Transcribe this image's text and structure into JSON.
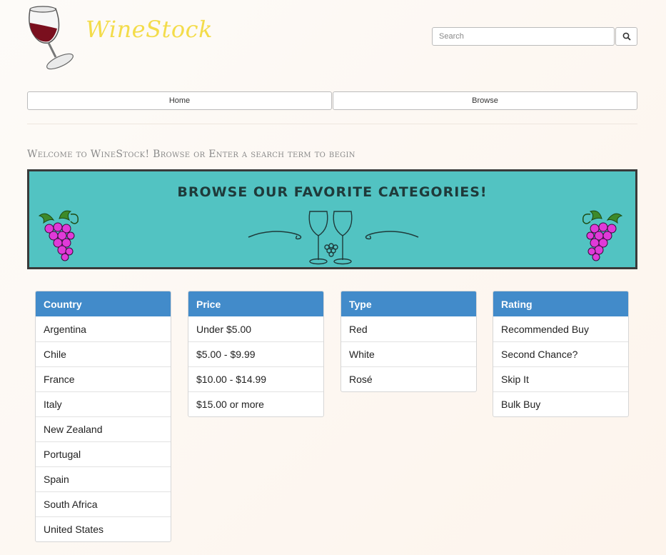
{
  "brand": {
    "name": "WineStock",
    "logo_icon": "wine-glass-icon",
    "accent": "#f3dc4a"
  },
  "search": {
    "placeholder": "Search",
    "icon": "search-icon"
  },
  "nav": {
    "home_label": "Home",
    "browse_label": "Browse"
  },
  "welcome": "Welcome to WineStock! Browse or Enter a search term to begin",
  "banner": {
    "title": "Browse our favorite categories!",
    "background": "#52c3c2",
    "icons": [
      "grapes-icon",
      "wine-glasses-icon",
      "grapes-icon"
    ]
  },
  "categories": {
    "country": {
      "title": "Country",
      "items": [
        "Argentina",
        "Chile",
        "France",
        "Italy",
        "New Zealand",
        "Portugal",
        "Spain",
        "South Africa",
        "United States"
      ]
    },
    "price": {
      "title": "Price",
      "items": [
        "Under $5.00",
        "$5.00 - $9.99",
        "$10.00 - $14.99",
        "$15.00 or more"
      ]
    },
    "type": {
      "title": "Type",
      "items": [
        "Red",
        "White",
        "Rosé"
      ]
    },
    "rating": {
      "title": "Rating",
      "items": [
        "Recommended Buy",
        "Second Chance?",
        "Skip It",
        "Bulk Buy"
      ]
    }
  },
  "colors": {
    "panel_header": "#428bca",
    "grape": "#e03ad8"
  }
}
